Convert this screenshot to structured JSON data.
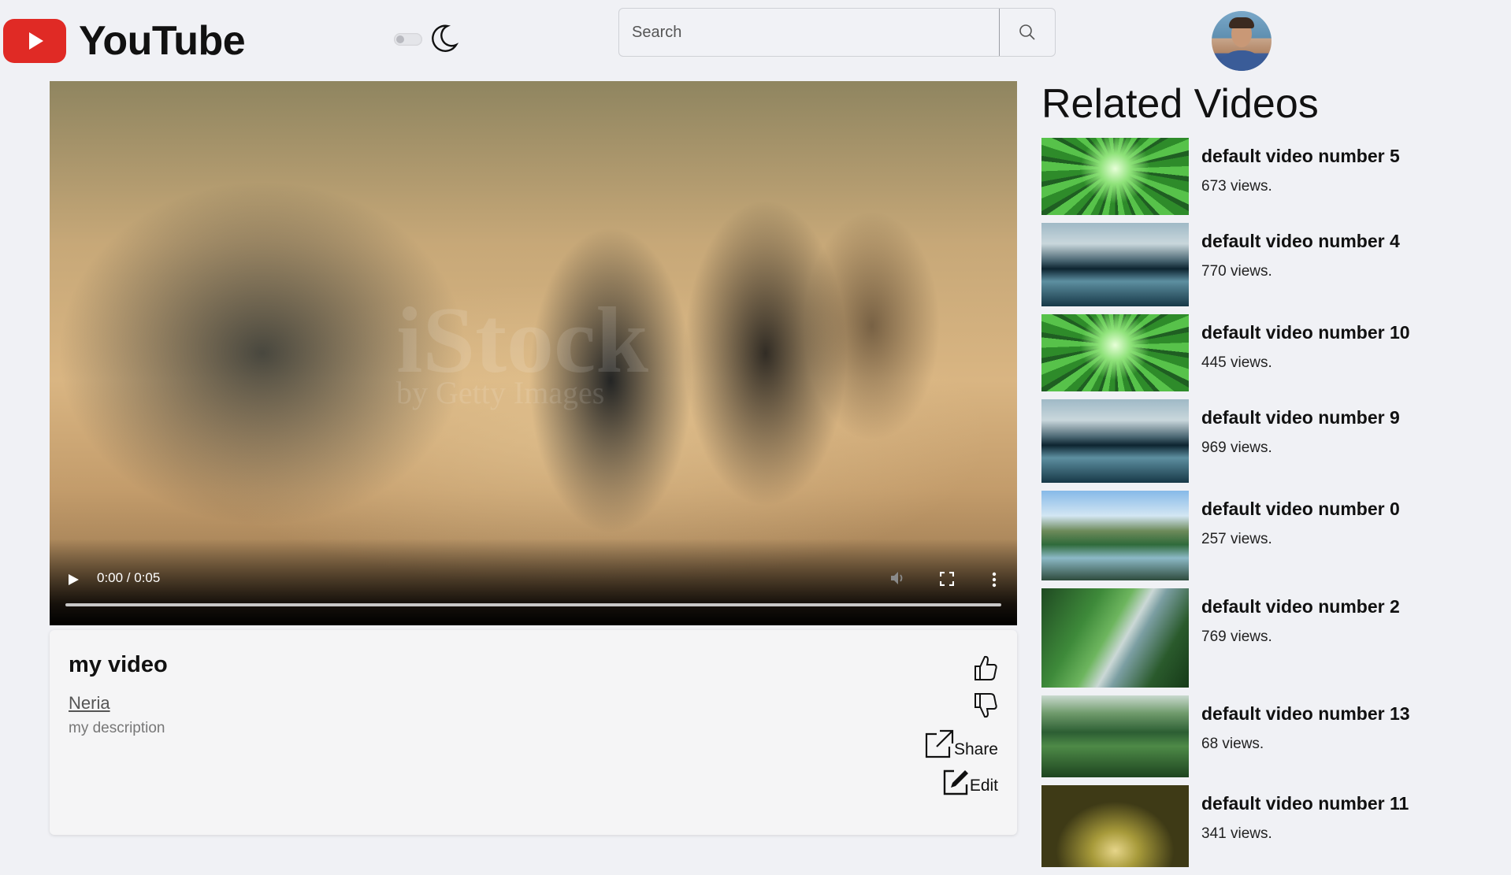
{
  "header": {
    "logo_text": "YouTube",
    "search_placeholder": "Search",
    "dark_mode_enabled": false
  },
  "video": {
    "time": "0:00 / 0:05",
    "watermark": "iStock",
    "watermark_sub": "by Getty Images",
    "progress": 0
  },
  "info": {
    "title": "my video",
    "channel": "Neria",
    "description": "my description",
    "share_label": "Share",
    "edit_label": "Edit"
  },
  "related": {
    "heading": "Related Videos",
    "items": [
      {
        "title": "default video number 5",
        "views": "673 views.",
        "thumb": "forest-canopy"
      },
      {
        "title": "default video number 4",
        "views": "770 views.",
        "thumb": "mountain-lake"
      },
      {
        "title": "default video number 10",
        "views": "445 views.",
        "thumb": "forest-canopy"
      },
      {
        "title": "default video number 9",
        "views": "969 views.",
        "thumb": "mountain-lake"
      },
      {
        "title": "default video number 0",
        "views": "257 views.",
        "thumb": "mountain-valley"
      },
      {
        "title": "default video number 2",
        "views": "769 views.",
        "thumb": "forest-stream"
      },
      {
        "title": "default video number 13",
        "views": "68 views.",
        "thumb": "waterfall"
      },
      {
        "title": "default video number 11",
        "views": "341 views.",
        "thumb": "tree-tunnel"
      }
    ]
  },
  "colors": {
    "background": "#f0f1f5",
    "brand_red": "#e02a25"
  }
}
